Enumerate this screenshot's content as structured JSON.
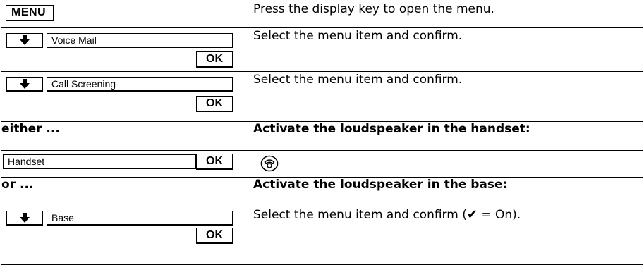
{
  "rows": [
    {
      "key": "MENU",
      "text": "Press the display key to open the menu."
    },
    {
      "field": "Voice Mail",
      "ok": "OK",
      "text": "Select the menu item and confirm."
    },
    {
      "field": "Call Screening",
      "ok": "OK",
      "text": "Select the menu item and confirm."
    },
    {
      "label": "either ...",
      "text": "Activate the loudspeaker in the handset:"
    },
    {
      "field": "Handset",
      "ok": "OK",
      "icon": "handset-key-icon"
    },
    {
      "label": "or ...",
      "text": "Activate the loudspeaker in the base:"
    },
    {
      "field": "Base",
      "ok": "OK",
      "text_before": "Select the menu item and confirm (",
      "check": "✔",
      "text_after": " = On)."
    }
  ]
}
